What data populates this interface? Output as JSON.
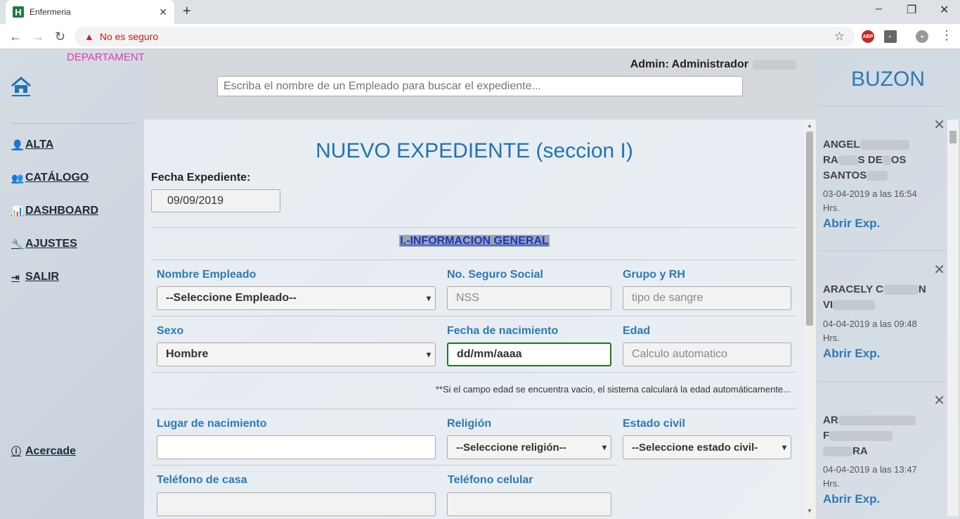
{
  "browser": {
    "tab_title": "Enfermeria",
    "tab_close": "✕",
    "new_tab": "+",
    "security_warning": "No es seguro",
    "url": ""
  },
  "sidebar": {
    "department": "DEPARTAMENTO DE ENFERMERIA",
    "items": [
      {
        "label": "ALTA",
        "icon": "user-icon"
      },
      {
        "label": "CATÁLOGO",
        "icon": "users-icon"
      },
      {
        "label": "DASHBOARD",
        "icon": "bar-chart-icon"
      },
      {
        "label": "AJUSTES",
        "icon": "wrench-icon"
      },
      {
        "label": "SALIR",
        "icon": "logout-icon"
      }
    ],
    "about": "Acercade"
  },
  "header": {
    "admin_label": "Admin: Administrador",
    "search_placeholder": "Escriba el nombre de un Empleado para buscar el expediente..."
  },
  "form": {
    "title": "NUEVO EXPEDIENTE (seccion I)",
    "fecha_label": "Fecha Expediente:",
    "fecha_value": "09/09/2019",
    "section_title": "I.-INFORMACION GENERAL",
    "nombre_label": "Nombre Empleado",
    "nombre_value": "--Seleccione Empleado--",
    "nss_label": "No. Seguro Social",
    "nss_placeholder": "NSS",
    "grupo_label": "Grupo y RH",
    "grupo_placeholder": "tipo de sangre",
    "sexo_label": "Sexo",
    "sexo_value": "Hombre",
    "nacimiento_label": "Fecha de nacimiento",
    "nacimiento_value": "dd/mm/aaaa",
    "edad_label": "Edad",
    "edad_placeholder": "Calculo automatico",
    "note": "**Si el campo edad se encuentra vacio, el sistema calculará la edad automáticamente...",
    "lugar_label": "Lugar de nacimiento",
    "religion_label": "Religión",
    "religion_value": "--Seleccione religión--",
    "estado_label": "Estado civil",
    "estado_value": "--Seleccione estado civil-",
    "tel_casa_label": "Teléfono de casa",
    "tel_cel_label": "Teléfono celular"
  },
  "buzon": {
    "title": "BUZON",
    "cards": [
      {
        "name_parts": [
          "ANGEL",
          "RA",
          "S",
          "DE",
          "OS",
          "SANTOS"
        ],
        "date": "03-04-2019 a las 16:54",
        "hrs": "Hrs.",
        "open": "Abrir Exp."
      },
      {
        "name_parts": [
          "ARACELY C",
          "N",
          "VI"
        ],
        "date": "04-04-2019 a las 09:48",
        "hrs": "Hrs.",
        "open": "Abrir Exp."
      },
      {
        "name_parts": [
          "AR",
          "F",
          "RA"
        ],
        "date": "04-04-2019 a las 13:47",
        "hrs": "Hrs.",
        "open": "Abrir Exp."
      }
    ]
  },
  "colors": {
    "accent": "#2a7ab8",
    "department": "#e23ba9",
    "focus": "#1c7a1c"
  }
}
